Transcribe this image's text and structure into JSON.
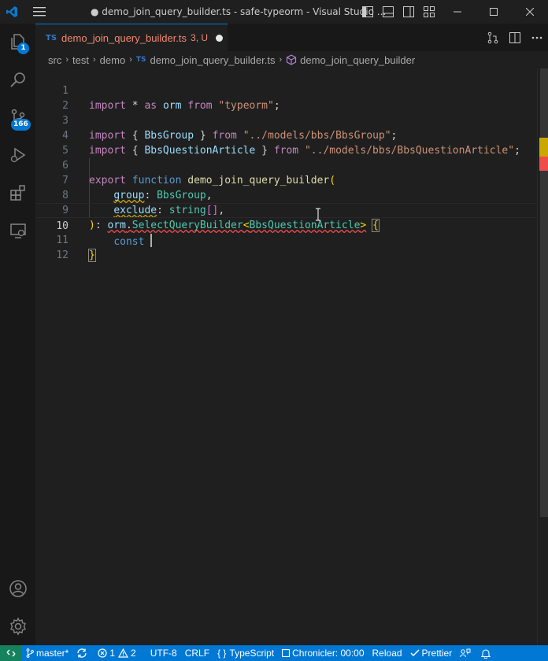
{
  "window": {
    "title": "● demo_join_query_builder.ts - safe-typeorm - Visual Studio ..."
  },
  "activity_bar": {
    "explorer_badge": "1",
    "scm_badge": "166"
  },
  "tab": {
    "lang_label": "TS",
    "filename": "demo_join_query_builder.ts",
    "status": "3, U"
  },
  "breadcrumb": {
    "parts": [
      "src",
      "test",
      "demo",
      "demo_join_query_builder.ts",
      "demo_join_query_builder"
    ],
    "lang_label": "TS"
  },
  "editor": {
    "line_numbers": [
      "1",
      "2",
      "3",
      "4",
      "5",
      "6",
      "7",
      "8",
      "9",
      "10",
      "11",
      "12"
    ],
    "active_line": "10",
    "tokens": {
      "l1": [
        "import",
        "*",
        "as",
        "orm",
        "from",
        "\"typeorm\"",
        ";"
      ],
      "l3": [
        "import",
        "{",
        "BbsGroup",
        "}",
        "from",
        "\"../models/bbs/BbsGroup\"",
        ";"
      ],
      "l4": [
        "import",
        "{",
        "BbsQuestionArticle",
        "}",
        "from",
        "\"../models/bbs/BbsQuestionArticle\"",
        ";"
      ],
      "l6": [
        "export",
        "function",
        "demo_join_query_builder",
        "("
      ],
      "l7": [
        "group",
        ":",
        "BbsGroup",
        ","
      ],
      "l8": [
        "exclude",
        ":",
        "string",
        "[]",
        ","
      ],
      "l9": [
        ")",
        ":",
        "orm",
        ".",
        "SelectQueryBuilder",
        "<",
        "BbsQuestionArticle",
        ">",
        "{"
      ],
      "l10": [
        "const"
      ],
      "l11": [
        "}"
      ]
    }
  },
  "status_bar": {
    "branch": "master*",
    "errors": "1",
    "warnings": "2",
    "encoding": "UTF-8",
    "eol": "CRLF",
    "language": "TypeScript",
    "language_prefix": "{ }",
    "chronicler": "Chronicler: 00:00",
    "reload": "Reload",
    "prettier": "Prettier"
  },
  "colors": {
    "accent": "#0078d4",
    "remote": "#16825d",
    "tab_modified": "#f48771"
  }
}
